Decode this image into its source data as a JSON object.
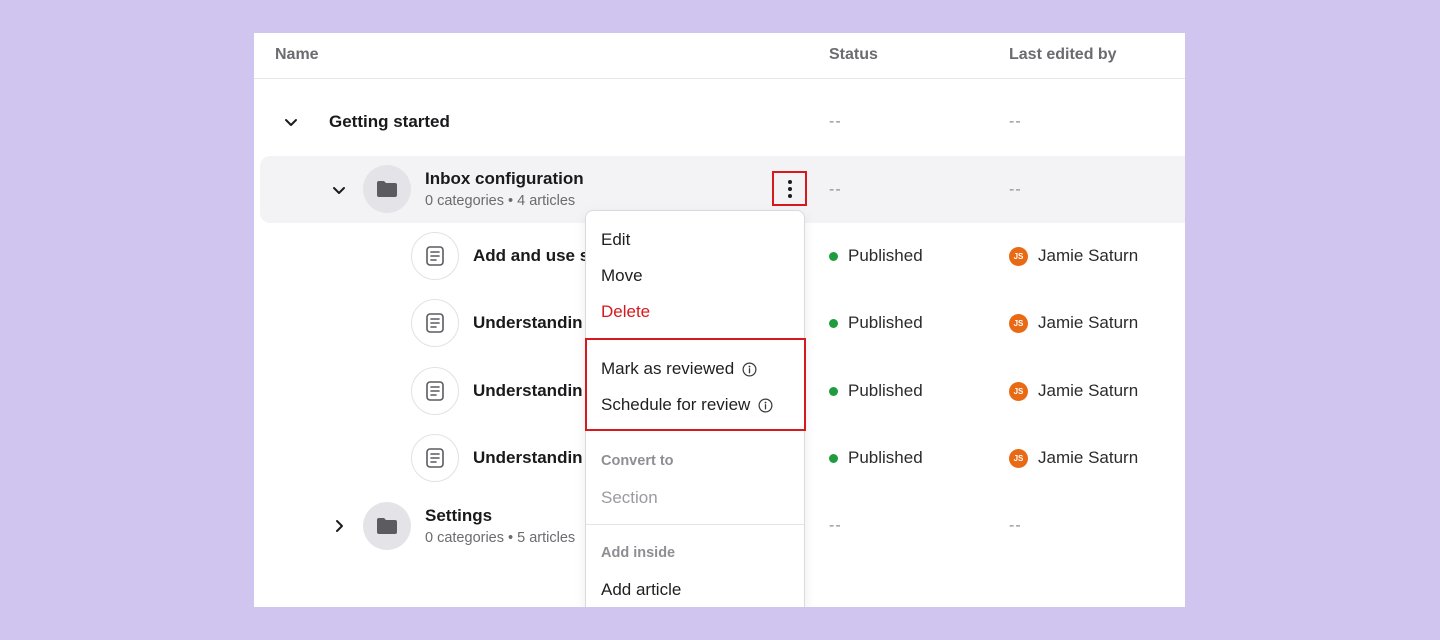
{
  "columns": {
    "name": "Name",
    "status": "Status",
    "last_edited_by": "Last edited by"
  },
  "placeholder": "--",
  "colors": {
    "background": "#d0c5ee",
    "published": "#1f9d3e",
    "danger": "#d7191c",
    "avatar": "#e86a14"
  },
  "rows": {
    "getting_started": {
      "title": "Getting started",
      "icon": "chevron-down-icon"
    },
    "inbox_configuration": {
      "title": "Inbox configuration",
      "categories": "0 categories",
      "separator": "•",
      "articles": "4 articles",
      "icon": "folder-icon"
    },
    "articles": [
      {
        "title": "Add and use s",
        "status": "Published",
        "editor_initials": "JS",
        "editor": "Jamie Saturn"
      },
      {
        "title": "Understandin",
        "status": "Published",
        "editor_initials": "JS",
        "editor": "Jamie Saturn"
      },
      {
        "title": "Understandin",
        "status": "Published",
        "editor_initials": "JS",
        "editor": "Jamie Saturn"
      },
      {
        "title": "Understandin",
        "status": "Published",
        "editor_initials": "JS",
        "editor": "Jamie Saturn"
      }
    ],
    "settings": {
      "title": "Settings",
      "categories": "0 categories",
      "separator": "•",
      "articles": "5 articles",
      "icon": "folder-icon"
    }
  },
  "menu": {
    "edit": "Edit",
    "move": "Move",
    "delete": "Delete",
    "mark_reviewed": "Mark as reviewed",
    "schedule_review": "Schedule for review",
    "convert_heading": "Convert to",
    "section": "Section",
    "add_inside_heading": "Add inside",
    "add_article": "Add article"
  }
}
